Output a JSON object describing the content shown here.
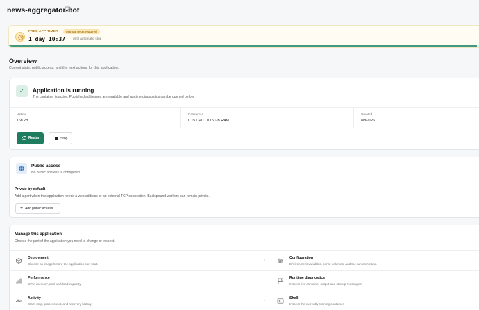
{
  "app": {
    "title": "news-aggregator-bot"
  },
  "timer": {
    "label": "FREE APP TIMER",
    "badge": "Manual reset required",
    "value": "1 day 10:37",
    "suffix": "until automatic stop",
    "progress": 0.98,
    "accent": "#3f9a80"
  },
  "overview": {
    "title": "Overview",
    "subtitle": "Current state, public access, and the next actions for this application."
  },
  "status": {
    "title": "Application is running",
    "description": "The container is active. Published addresses are available and runtime diagnostics can be opened below.",
    "metrics": [
      {
        "label": "Uptime",
        "value": "16h 2m"
      },
      {
        "label": "Resources",
        "value": "0.15 CPU / 0.15 GB RAM"
      },
      {
        "label": "Created",
        "value": "8/8/2026"
      }
    ],
    "restart_label": "Restart",
    "stop_label": "Stop",
    "primary_color": "#1e7d5f"
  },
  "public_access": {
    "title": "Public access",
    "subtitle": "No public address is configured.",
    "private_title": "Private by default",
    "private_desc": "Add a port when this application needs a web address or an external TCP connection. Background workers can remain private.",
    "add_label": "Add public access"
  },
  "manage": {
    "title": "Manage this application",
    "subtitle": "Choose the part of the application you need to change or inspect.",
    "items": [
      {
        "title": "Deployment",
        "desc": "Choose an image before the application can start.",
        "icon": "box-icon"
      },
      {
        "title": "Configuration",
        "desc": "Environment variables, ports, volumes, and the run command.",
        "icon": "sliders-icon"
      },
      {
        "title": "Performance",
        "desc": "CPU, memory, and workload capacity.",
        "icon": "bar-chart-icon"
      },
      {
        "title": "Runtime diagnostics",
        "desc": "Inspect live container output and startup messages.",
        "icon": "flag-icon"
      },
      {
        "title": "Activity",
        "desc": "Start, stop, process exit, and recovery history.",
        "icon": "activity-icon"
      },
      {
        "title": "Shell",
        "desc": "Inspect the currently running container.",
        "icon": "terminal-icon"
      }
    ]
  }
}
